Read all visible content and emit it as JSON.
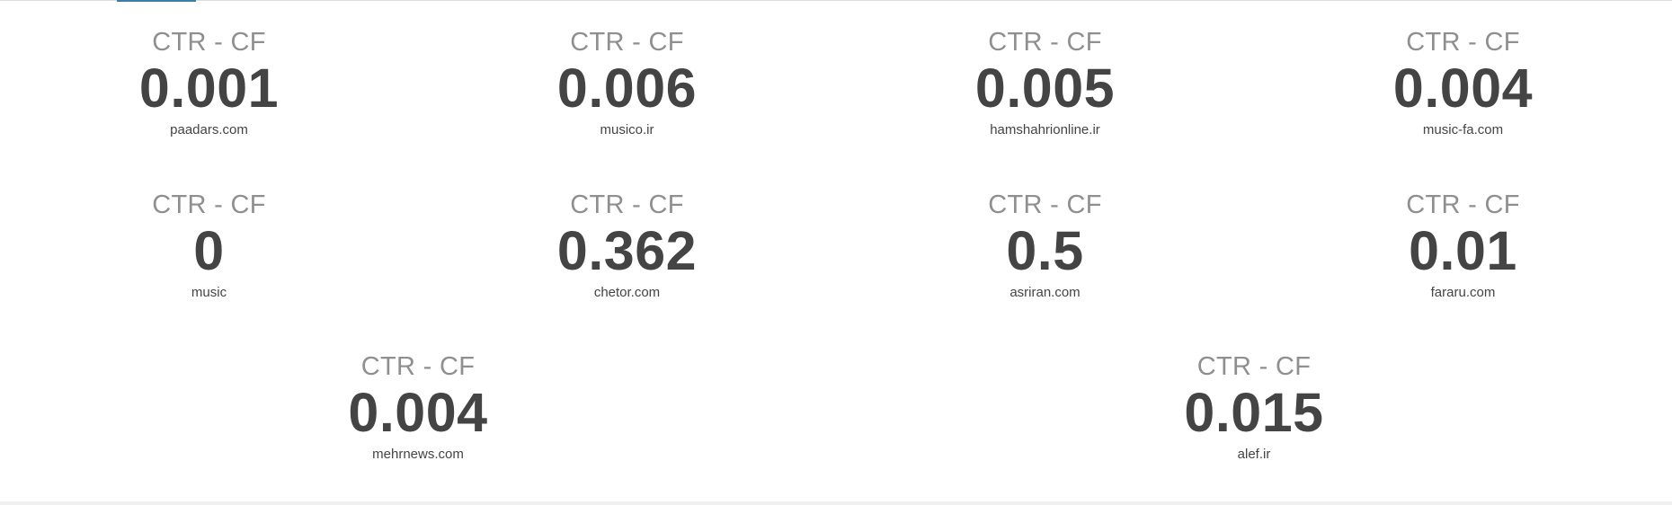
{
  "stats": [
    {
      "label": "CTR - CF",
      "value": "0.001",
      "site": "paadars.com"
    },
    {
      "label": "CTR - CF",
      "value": "0.006",
      "site": "musico.ir"
    },
    {
      "label": "CTR - CF",
      "value": "0.005",
      "site": "hamshahrionline.ir"
    },
    {
      "label": "CTR - CF",
      "value": "0.004",
      "site": "music-fa.com"
    },
    {
      "label": "CTR - CF",
      "value": "0",
      "site": "music"
    },
    {
      "label": "CTR - CF",
      "value": "0.362",
      "site": "chetor.com"
    },
    {
      "label": "CTR - CF",
      "value": "0.5",
      "site": "asriran.com"
    },
    {
      "label": "CTR - CF",
      "value": "0.01",
      "site": "fararu.com"
    },
    {
      "label": "CTR - CF",
      "value": "0.004",
      "site": "mehrnews.com"
    },
    {
      "label": "CTR - CF",
      "value": "0.015",
      "site": "alef.ir"
    }
  ],
  "colors": {
    "label": "#8f8f8f",
    "value": "#444444",
    "accent": "#3d7ea8"
  }
}
